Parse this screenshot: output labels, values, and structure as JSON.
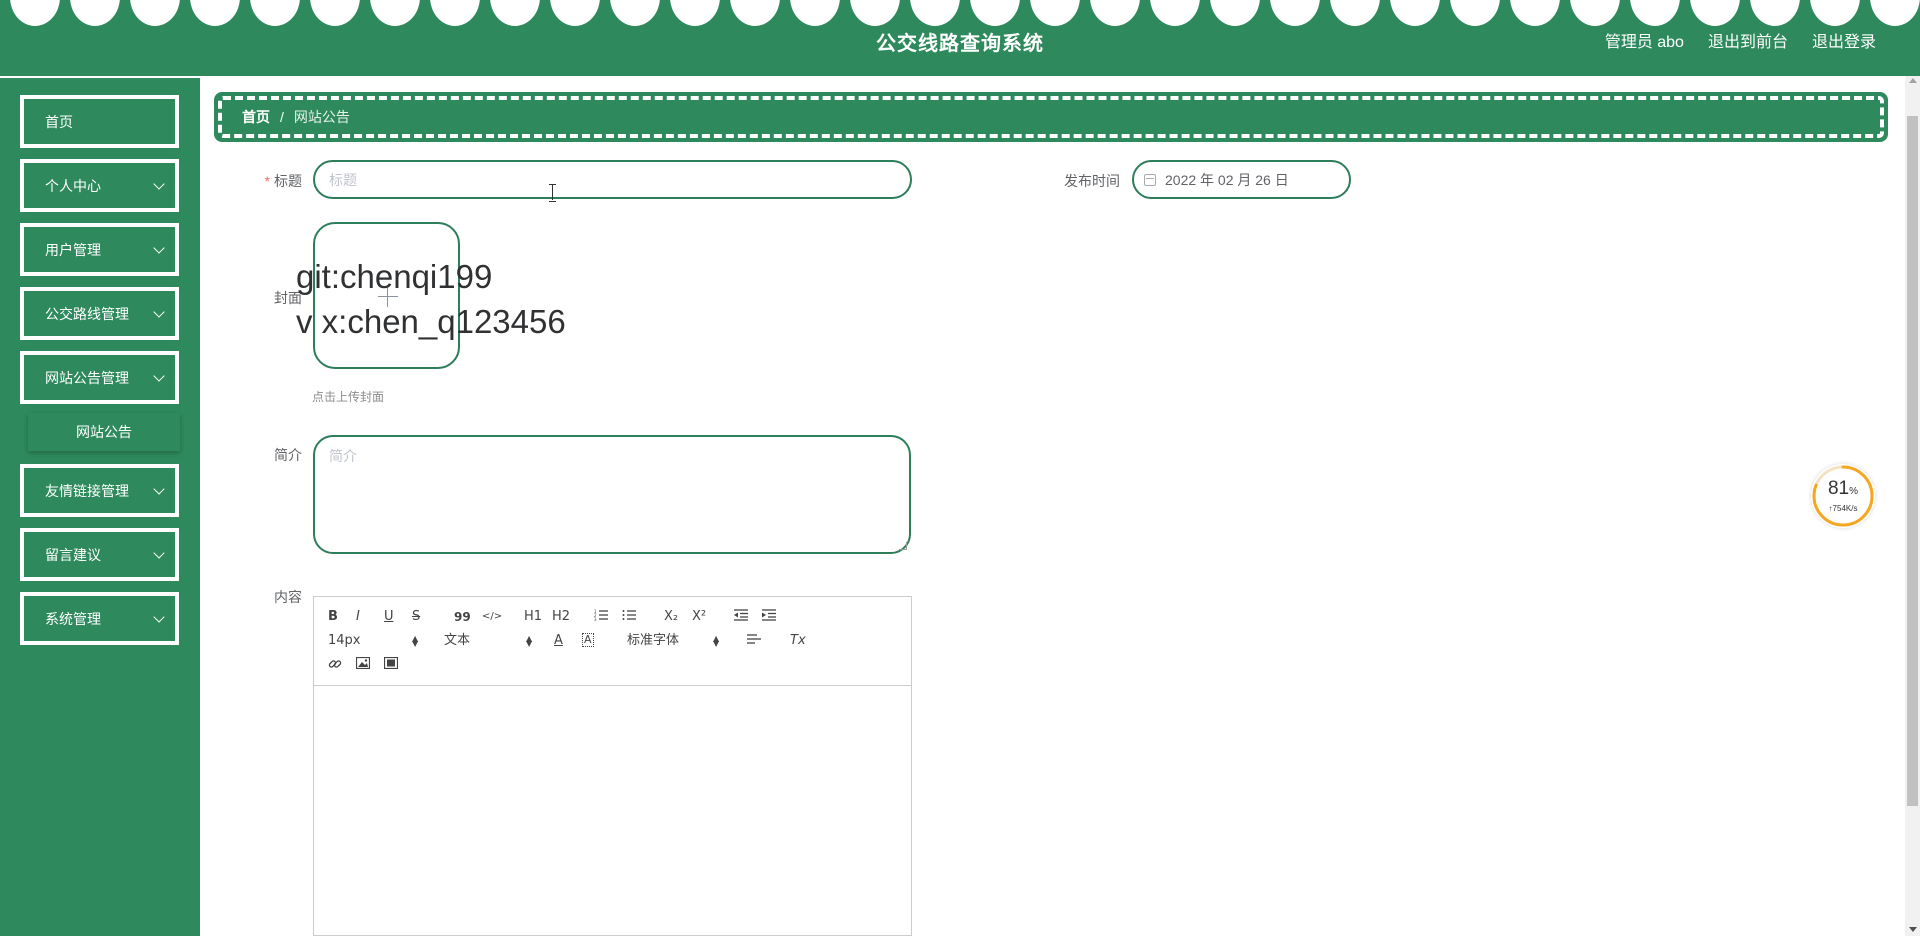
{
  "header": {
    "title": "公交线路查询系统",
    "user_label": "管理员 abo",
    "front_link": "退出到前台",
    "logout_link": "退出登录",
    "color": "#2e8a5c"
  },
  "sidebar": {
    "items": [
      {
        "label": "首页",
        "has_children": false
      },
      {
        "label": "个人中心",
        "has_children": true
      },
      {
        "label": "用户管理",
        "has_children": true
      },
      {
        "label": "公交路线管理",
        "has_children": true
      },
      {
        "label": "网站公告管理",
        "has_children": true,
        "expanded": true
      },
      {
        "label": "网站公告",
        "is_submenu": true
      },
      {
        "label": "友情链接管理",
        "has_children": true
      },
      {
        "label": "留言建议",
        "has_children": true
      },
      {
        "label": "系统管理",
        "has_children": true
      }
    ]
  },
  "breadcrumb": {
    "home": "首页",
    "separator": "/",
    "current": "网站公告"
  },
  "form": {
    "title_label": "标题",
    "title_placeholder": "标题",
    "publish_label": "发布时间",
    "publish_value": "2022 年 02 月 26 日",
    "cover_label": "封面",
    "cover_tip": "点击上传封面",
    "intro_label": "简介",
    "intro_placeholder": "简介",
    "content_label": "内容"
  },
  "watermark": {
    "line1": "git:chenqi199",
    "line2": "v x:chen_q123456"
  },
  "editor": {
    "font_size": "14px",
    "header_select": "文本",
    "font_family": "标准字体",
    "buttons": [
      "bold-icon",
      "italic-icon",
      "underline-icon",
      "strike-icon",
      "blockquote-icon",
      "code-block-icon",
      "h1-icon",
      "h2-icon",
      "ordered-list-icon",
      "bullet-list-icon",
      "subscript-icon",
      "superscript-icon",
      "outdent-icon",
      "indent-icon",
      "font-color-icon",
      "background-color-icon",
      "align-icon",
      "clean-icon",
      "link-icon",
      "image-icon",
      "video-icon"
    ],
    "glyphs": {
      "bold": "B",
      "italic": "I",
      "underline": "U",
      "strike": "S",
      "quote": "99",
      "code": "</>",
      "h1": "H1",
      "h2": "H2",
      "sub": "X₂",
      "sup": "X²",
      "color": "A",
      "bg": "A",
      "clean": "Tx"
    }
  },
  "net_widget": {
    "percent_value": 81,
    "percent": "81",
    "percent_sign": "%",
    "speed": "↑754K/s",
    "ring_color": "#f5a623"
  }
}
